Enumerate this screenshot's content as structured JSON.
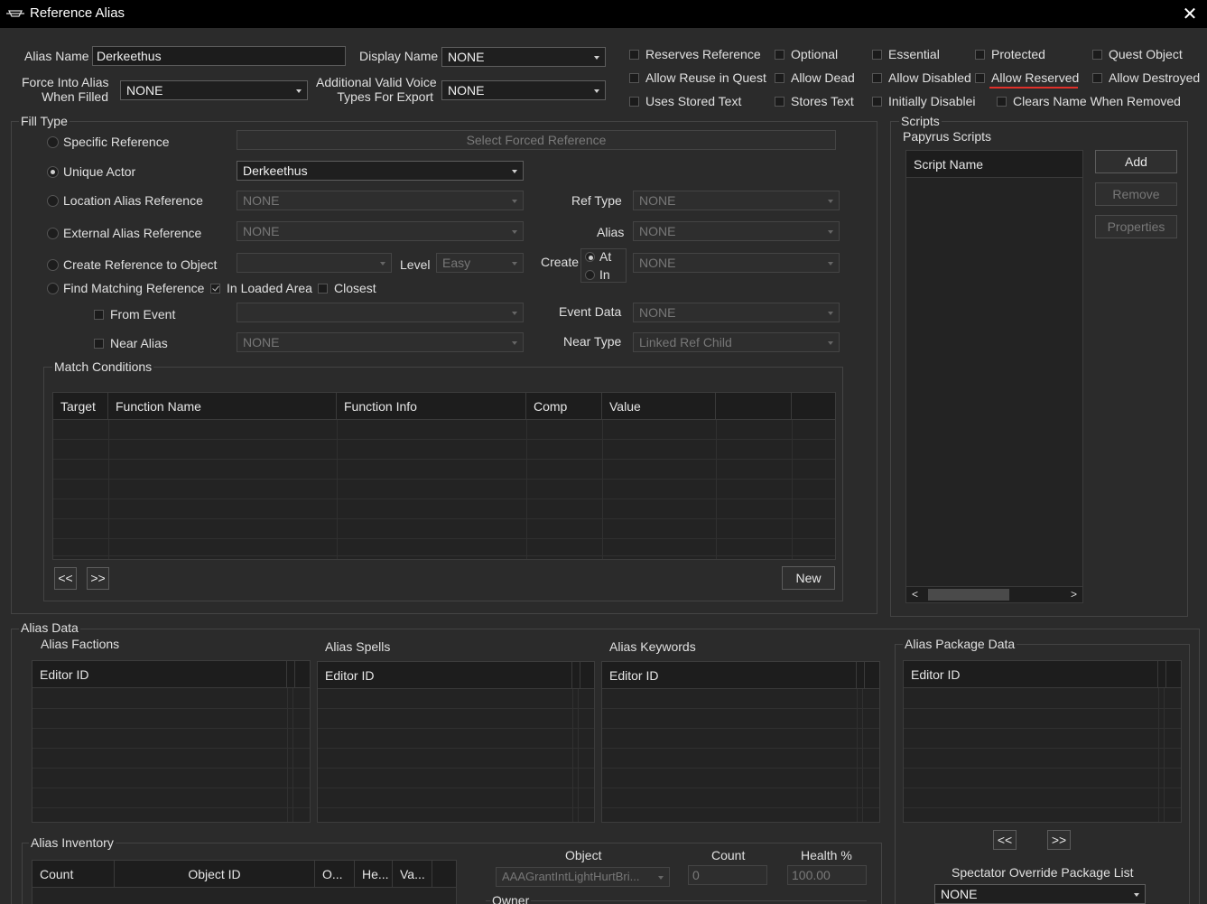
{
  "window": {
    "title": "Reference Alias",
    "close_glyph": "✕"
  },
  "top": {
    "alias_name_label": "Alias Name",
    "alias_name_value": "Derkeethus",
    "display_name_label": "Display Name",
    "display_name_value": "NONE",
    "force_into_alias_label_1": "Force Into Alias",
    "force_into_alias_label_2": "When Filled",
    "force_into_alias_value": "NONE",
    "voice_types_label_1": "Additional Valid Voice",
    "voice_types_label_2": "Types For Export",
    "voice_types_value": "NONE"
  },
  "flags": [
    {
      "label": "Reserves Reference",
      "checked": false
    },
    {
      "label": "Optional",
      "checked": false
    },
    {
      "label": "Essential",
      "checked": false
    },
    {
      "label": "Protected",
      "checked": false
    },
    {
      "label": "Quest Object",
      "checked": false
    },
    {
      "label": "Allow Reuse in Quest",
      "checked": false
    },
    {
      "label": "Allow Dead",
      "checked": false
    },
    {
      "label": "Allow Disabled",
      "checked": false
    },
    {
      "label": "Allow Reserved",
      "checked": false
    },
    {
      "label": "Allow Destroyed",
      "checked": false
    },
    {
      "label": "Uses Stored Text",
      "checked": false
    },
    {
      "label": "Stores Text",
      "checked": false
    },
    {
      "label": "Initially Disablei",
      "checked": false
    },
    {
      "label": "Clears Name When Removed",
      "checked": false
    }
  ],
  "highlight_color": "#e0302a",
  "fill_type": {
    "title": "Fill Type",
    "specific_reference": "Specific Reference",
    "select_forced_reference": "Select Forced Reference",
    "unique_actor": "Unique Actor",
    "unique_actor_value": "Derkeethus",
    "location_alias_reference": "Location Alias Reference",
    "location_alias_value": "NONE",
    "ref_type_label": "Ref Type",
    "ref_type_value": "NONE",
    "external_alias_reference": "External Alias Reference",
    "external_alias_value": "NONE",
    "alias_label": "Alias",
    "alias_value": "NONE",
    "create_reference": "Create Reference to Object",
    "create_reference_value": "",
    "level_label": "Level",
    "level_value": "Easy",
    "create_label": "Create",
    "create_at": "At",
    "create_in": "In",
    "create_value": "NONE",
    "find_matching": "Find Matching Reference",
    "in_loaded_area": "In Loaded Area",
    "closest": "Closest",
    "from_event": "From Event",
    "from_event_value": "",
    "event_data_label": "Event Data",
    "event_data_value": "NONE",
    "near_alias": "Near Alias",
    "near_alias_value": "NONE",
    "near_type_label": "Near Type",
    "near_type_value": "Linked Ref Child",
    "selected": "Unique Actor"
  },
  "match_conditions": {
    "title": "Match Conditions",
    "columns": [
      "Target",
      "Function Name",
      "Function Info",
      "Comp",
      "Value",
      "",
      ""
    ],
    "prev": "<<",
    "next": ">>",
    "new": "New"
  },
  "scripts": {
    "title": "Scripts",
    "subtitle": "Papyrus Scripts",
    "column": "Script Name",
    "add": "Add",
    "remove": "Remove",
    "properties": "Properties",
    "scroll_left": "<",
    "scroll_right": ">"
  },
  "alias_data": {
    "title": "Alias Data",
    "factions_title": "Alias Factions",
    "spells_title": "Alias Spells",
    "keywords_title": "Alias Keywords",
    "package_title": "Alias Package Data",
    "editor_id": "Editor ID",
    "pkg_prev": "<<",
    "pkg_next": ">>",
    "spectator_label": "Spectator Override Package List",
    "spectator_value": "NONE"
  },
  "inventory": {
    "title": "Alias Inventory",
    "columns": [
      "Count",
      "Object ID",
      "O...",
      "He...",
      "Va..."
    ],
    "object_label": "Object",
    "object_value": "AAAGrantIntLightHurtBri...",
    "count_label": "Count",
    "count_value": "0",
    "health_label": "Health %",
    "health_value": "100.00",
    "owner_label": "Owner"
  }
}
